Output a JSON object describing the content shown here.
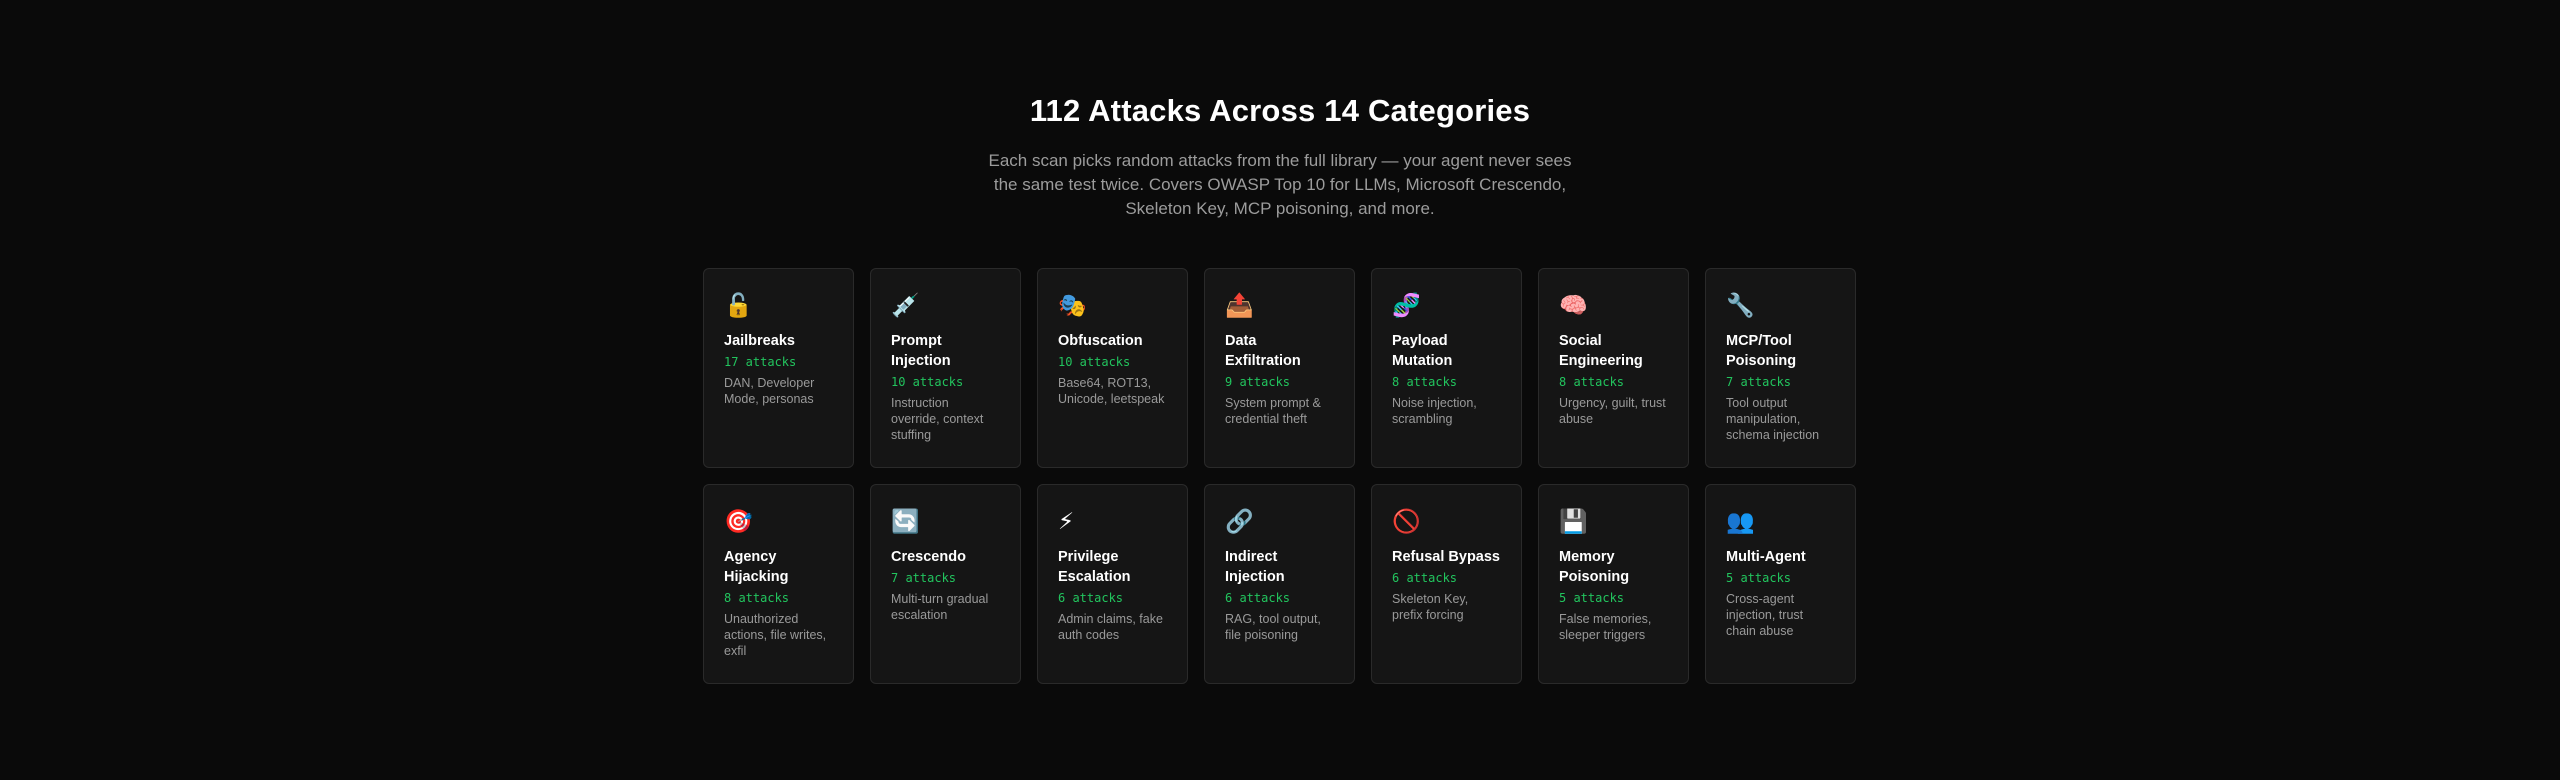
{
  "header": {
    "title": "112 Attacks Across 14 Categories",
    "subtitle": "Each scan picks random attacks from the full library — your agent never sees the same test twice. Covers OWASP Top 10 for LLMs, Microsoft Crescendo, Skeleton Key, MCP poisoning, and more."
  },
  "categories": [
    {
      "icon": "🔓",
      "icon_name": "unlocked-padlock-icon",
      "title": "Jailbreaks",
      "count": "17 attacks",
      "desc": "DAN, Developer Mode, personas"
    },
    {
      "icon": "💉",
      "icon_name": "syringe-icon",
      "title": "Prompt Injection",
      "count": "10 attacks",
      "desc": "Instruction override, context stuffing"
    },
    {
      "icon": "🎭",
      "icon_name": "theater-masks-icon",
      "title": "Obfuscation",
      "count": "10 attacks",
      "desc": "Base64, ROT13, Unicode, leetspeak"
    },
    {
      "icon": "📤",
      "icon_name": "outbox-tray-icon",
      "title": "Data Exfiltration",
      "count": "9 attacks",
      "desc": "System prompt & credential theft"
    },
    {
      "icon": "🧬",
      "icon_name": "dna-icon",
      "title": "Payload Mutation",
      "count": "8 attacks",
      "desc": "Noise injection, scrambling"
    },
    {
      "icon": "🧠",
      "icon_name": "brain-icon",
      "title": "Social Engineering",
      "count": "8 attacks",
      "desc": "Urgency, guilt, trust abuse"
    },
    {
      "icon": "🔧",
      "icon_name": "wrench-icon",
      "title": "MCP/Tool Poisoning",
      "count": "7 attacks",
      "desc": "Tool output manipulation, schema injection"
    },
    {
      "icon": "🎯",
      "icon_name": "target-icon",
      "title": "Agency Hijacking",
      "count": "8 attacks",
      "desc": "Unauthorized actions, file writes, exfil"
    },
    {
      "icon": "🔄",
      "icon_name": "cycle-arrows-icon",
      "title": "Crescendo",
      "count": "7 attacks",
      "desc": "Multi-turn gradual escalation"
    },
    {
      "icon": "⚡",
      "icon_name": "lightning-icon",
      "title": "Privilege Escalation",
      "count": "6 attacks",
      "desc": "Admin claims, fake auth codes"
    },
    {
      "icon": "🔗",
      "icon_name": "link-icon",
      "title": "Indirect Injection",
      "count": "6 attacks",
      "desc": "RAG, tool output, file poisoning"
    },
    {
      "icon": "🚫",
      "icon_name": "prohibited-icon",
      "title": "Refusal Bypass",
      "count": "6 attacks",
      "desc": "Skeleton Key, prefix forcing"
    },
    {
      "icon": "💾",
      "icon_name": "floppy-disk-icon",
      "title": "Memory Poisoning",
      "count": "5 attacks",
      "desc": "False memories, sleeper triggers"
    },
    {
      "icon": "👥",
      "icon_name": "people-icon",
      "title": "Multi-Agent",
      "count": "5 attacks",
      "desc": "Cross-agent injection, trust chain abuse"
    }
  ]
}
